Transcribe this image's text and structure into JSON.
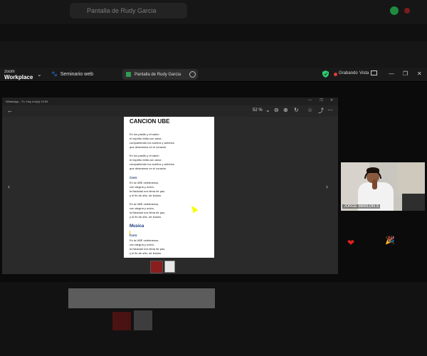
{
  "background": {
    "tab_title": "Pantalla de Rudy Garcia"
  },
  "zoom_bar": {
    "logo_small": "zoom",
    "logo_big": "Workplace",
    "webinar_label": "Seminario web",
    "share_label": "Pantalla de Rudy Garcia",
    "recording_label": "Grabando",
    "view_label": "Vista"
  },
  "whatsapp": {
    "title": "WhatsApp - Tú, Hoy a la(s) 19:09",
    "zoom_percent": "52 %",
    "document": {
      "title": "CANCION UBE",
      "stanza1": [
        "En los pasillo y el salón",
        "el espíritu brilla con amor,",
        "compartiendo los  sueños  y anhelos",
        "que deseamos en el corazón."
      ],
      "stanza2": [
        "En los pasillo y el salón",
        "el espíritu brilla con amor,",
        "compartiendo los  sueños  y anhelos",
        "que deseamos en el corazón."
      ],
      "coro_label": "Coro",
      "coro1": [
        "En la UBE celebramos,",
        "con alegría y unión,",
        "la Navidad nos llena de paz,",
        "y el fin de año, de ilusión."
      ],
      "coro2": [
        "En la UBE celebramos,",
        "con alegría y unión,",
        "la Navidad nos llena de paz,",
        "y el fin de año, de ilusión."
      ],
      "musica_label": "Musica",
      "coro3": [
        "En la UBE celebramos,",
        "con alegría y unión,",
        "la Navidad nos llena de paz,",
        "y el fin de año, de ilusión."
      ]
    }
  },
  "participant": {
    "name": "JORGE MARLON S"
  },
  "reactions": {
    "heart": "❤",
    "party": "🎉"
  },
  "colors": {
    "accent_green": "#2e9e55",
    "recording_red": "#e53935",
    "doc_heading_blue": "#1a3a7a"
  }
}
